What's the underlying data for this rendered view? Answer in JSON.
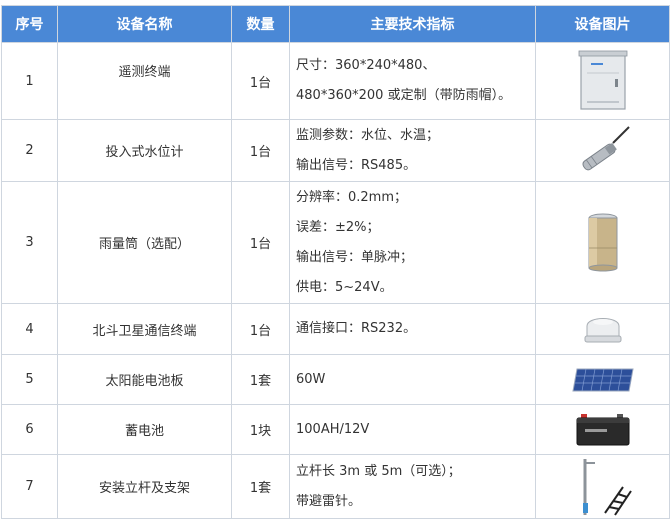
{
  "headers": [
    "序号",
    "设备名称",
    "数量",
    "主要技术指标",
    "设备图片"
  ],
  "rows": [
    {
      "no": "1",
      "name": "遥测终端",
      "qty": "1台",
      "specs": [
        "尺寸：360*240*480、",
        "480*360*200 或定制（带防雨帽）。"
      ],
      "icon": "enclosure-cabinet-icon"
    },
    {
      "no": "2",
      "name": "投入式水位计",
      "qty": "1台",
      "specs": [
        "监测参数：水位、水温；",
        "输出信号：RS485。"
      ],
      "icon": "submersible-level-sensor-icon"
    },
    {
      "no": "3",
      "name": "雨量筒（选配）",
      "qty": "1台",
      "specs": [
        "分辨率：0.2mm；",
        "误差：±2%；",
        "输出信号：单脉冲；",
        "供电：5~24V。"
      ],
      "icon": "rain-gauge-icon"
    },
    {
      "no": "4",
      "name": "北斗卫星通信终端",
      "qty": "1台",
      "specs": [
        "通信接口：RS232。"
      ],
      "icon": "satellite-terminal-icon"
    },
    {
      "no": "5",
      "name": "太阳能电池板",
      "qty": "1套",
      "specs": [
        "60W"
      ],
      "icon": "solar-panel-icon"
    },
    {
      "no": "6",
      "name": "蓄电池",
      "qty": "1块",
      "specs": [
        "100AH/12V"
      ],
      "icon": "battery-icon"
    },
    {
      "no": "7",
      "name": "安装立杆及支架",
      "qty": "1套",
      "specs": [
        "立杆长 3m 或 5m（可选）；",
        "带避雷针。"
      ],
      "icon": "mounting-pole-icon"
    }
  ]
}
